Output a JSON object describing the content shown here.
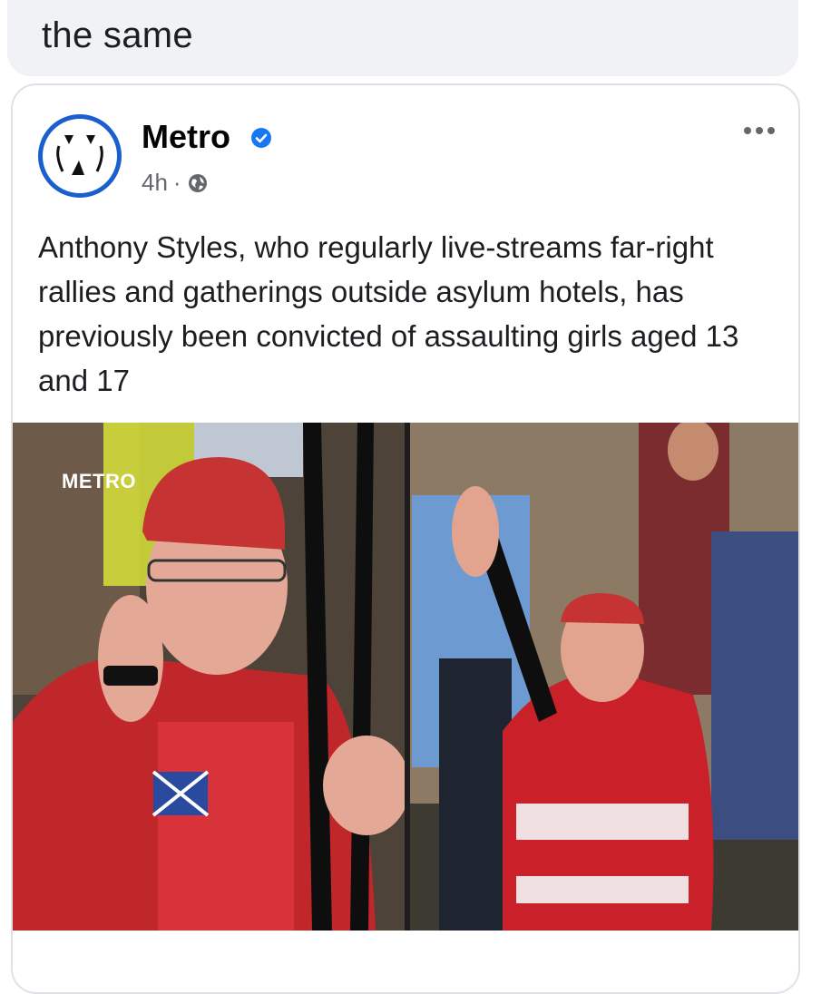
{
  "comment": {
    "text": "the same"
  },
  "post": {
    "page_name": "Metro",
    "verified": true,
    "time": "4h",
    "separator": "·",
    "audience_icon": "globe-icon",
    "text": "Anthony Styles, who regularly live-streams far-right rallies and gatherings outside asylum hotels, has previously been convicted of assaulting girls aged 13 and 17",
    "image": {
      "watermark": "METRO"
    }
  },
  "colors": {
    "brand_blue": "#1b5fcf",
    "verified_blue": "#1877f2",
    "bubble_bg": "#f0f2f5",
    "secondary_text": "#65676b"
  }
}
